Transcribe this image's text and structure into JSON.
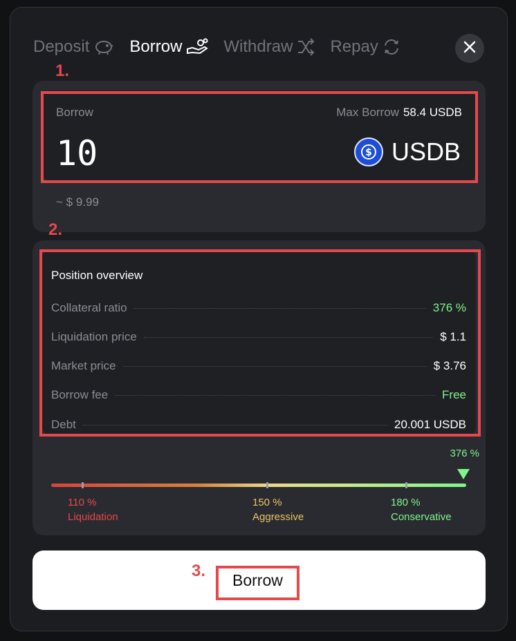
{
  "tabs": [
    {
      "label": "Deposit",
      "icon": "piggy-bank-icon",
      "active": false
    },
    {
      "label": "Borrow",
      "icon": "hand-coins-icon",
      "active": true
    },
    {
      "label": "Withdraw",
      "icon": "shuffle-icon",
      "active": false
    },
    {
      "label": "Repay",
      "icon": "refresh-icon",
      "active": false
    }
  ],
  "annotations": {
    "step1": "1.",
    "step2": "2.",
    "step3": "3."
  },
  "borrow_input": {
    "label": "Borrow",
    "max_label": "Max Borrow",
    "max_value": "58.4 USDB",
    "amount": "10",
    "token": "USDB",
    "usd_estimate": "~ $ 9.99"
  },
  "position_overview": {
    "title": "Position overview",
    "rows": [
      {
        "label": "Collateral ratio",
        "value": "376 %",
        "tone": "green"
      },
      {
        "label": "Liquidation price",
        "value": "$ 1.1",
        "tone": "white"
      },
      {
        "label": "Market price",
        "value": "$ 3.76",
        "tone": "white"
      },
      {
        "label": "Borrow fee",
        "value": "Free",
        "tone": "green"
      },
      {
        "label": "Debt",
        "value": "20.001 USDB",
        "tone": "white"
      }
    ]
  },
  "gauge": {
    "current": "376 %",
    "legend": [
      {
        "pct": "110 %",
        "label": "Liquidation",
        "color": "#e5484d"
      },
      {
        "pct": "150 %",
        "label": "Aggressive",
        "color": "#e9c46a"
      },
      {
        "pct": "180 %",
        "label": "Conservative",
        "color": "#7ff58b"
      }
    ]
  },
  "submit_label": "Borrow",
  "colors": {
    "accent_green": "#7ff58b",
    "annotation_red": "#e5484d",
    "usdb_blue": "#1d4ed8"
  }
}
